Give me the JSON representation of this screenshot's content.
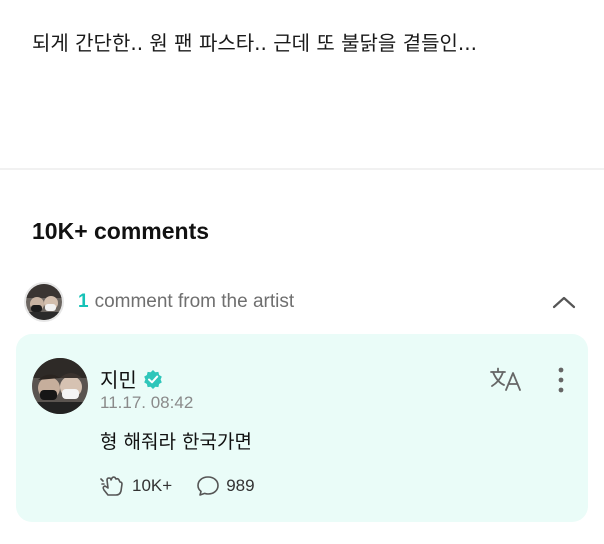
{
  "post": {
    "text": "되게 간단한.. 원 팬 파스타.. 근데 또 불닭을 곁들인..."
  },
  "comments": {
    "count_label": "10K+ comments"
  },
  "artist_comments": {
    "count": "1",
    "label": "comment from the artist",
    "chevron_icon": "chevron-up-icon"
  },
  "comment": {
    "author": "지민",
    "verified_icon": "verified-badge-icon",
    "timestamp": "11.17. 08:42",
    "body": "형 해줘라 한국가면",
    "likes": "10K+",
    "replies": "989",
    "like_icon": "cheer-hand-icon",
    "reply_icon": "speech-bubble-icon",
    "translate_icon": "translate-icon",
    "more_icon": "more-vertical-icon"
  },
  "colors": {
    "accent": "#16c2b7",
    "card_background": "#eafcf8",
    "verified": "#2fc6ba"
  }
}
